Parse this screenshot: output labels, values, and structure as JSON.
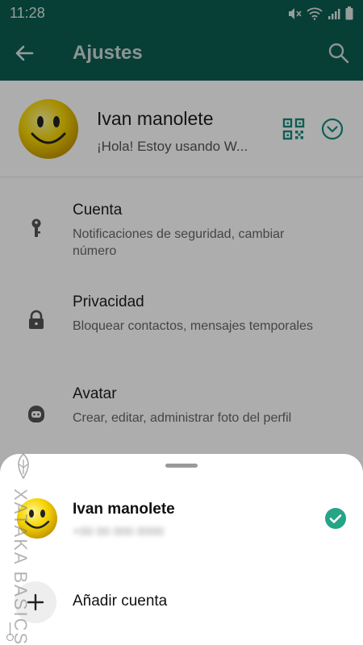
{
  "status_bar": {
    "time": "11:28"
  },
  "app_bar": {
    "title": "Ajustes"
  },
  "profile": {
    "name": "Ivan manolete",
    "status": "¡Hola! Estoy usando W..."
  },
  "menu": [
    {
      "title": "Cuenta",
      "subtitle": "Notificaciones de seguridad, cambiar número",
      "icon": "key-icon"
    },
    {
      "title": "Privacidad",
      "subtitle": "Bloquear contactos, mensajes temporales",
      "icon": "lock-icon"
    },
    {
      "title": "Avatar",
      "subtitle": "Crear, editar, administrar foto del perfil",
      "icon": "avatar-icon"
    }
  ],
  "sheet": {
    "account_name": "Ivan manolete",
    "account_phone": "+00 00 000 0000",
    "add_account_label": "Añadir cuenta"
  },
  "watermark": {
    "text": "XATAKA BASICS"
  },
  "colors": {
    "app_bar": "#0b5e52",
    "accent": "#128c7e",
    "check": "#25a586"
  }
}
